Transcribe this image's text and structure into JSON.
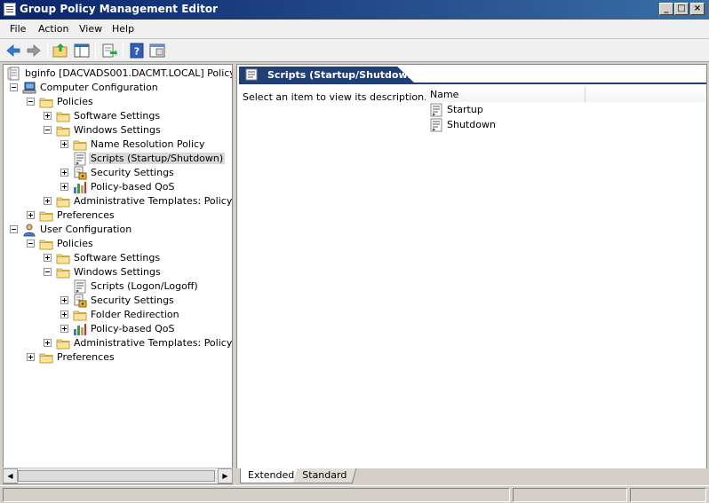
{
  "window": {
    "title": "Group Policy Management Editor"
  },
  "menu": [
    "File",
    "Action",
    "View",
    "Help"
  ],
  "toolbar": [
    "back-icon",
    "forward-icon",
    "up-folder-icon",
    "show-hide-tree-icon",
    "export-list-icon",
    "help-icon",
    "properties-icon"
  ],
  "tree": [
    {
      "label": "bginfo [DACVADS001.DACMT.LOCAL] Policy",
      "icon": "policy-doc-icon",
      "expander": "none",
      "level": 0
    },
    {
      "label": "Computer Configuration",
      "icon": "computer-icon",
      "expander": "minus",
      "level": 1
    },
    {
      "label": "Policies",
      "icon": "folder-icon",
      "expander": "minus",
      "level": 2
    },
    {
      "label": "Software Settings",
      "icon": "folder-icon",
      "expander": "plus",
      "level": 3
    },
    {
      "label": "Windows Settings",
      "icon": "folder-icon",
      "expander": "minus",
      "level": 3
    },
    {
      "label": "Name Resolution Policy",
      "icon": "folder-icon",
      "expander": "plus",
      "level": 4
    },
    {
      "label": "Scripts (Startup/Shutdown)",
      "icon": "script-icon",
      "expander": "none",
      "level": 4,
      "selected": true
    },
    {
      "label": "Security Settings",
      "icon": "security-icon",
      "expander": "plus",
      "level": 4
    },
    {
      "label": "Policy-based QoS",
      "icon": "qos-chart-icon",
      "expander": "plus",
      "level": 4
    },
    {
      "label": "Administrative Templates: Policy defi",
      "icon": "folder-icon",
      "expander": "plus",
      "level": 3
    },
    {
      "label": "Preferences",
      "icon": "folder-icon",
      "expander": "plus",
      "level": 2
    },
    {
      "label": "User Configuration",
      "icon": "user-icon",
      "expander": "minus",
      "level": 1
    },
    {
      "label": "Policies",
      "icon": "folder-icon",
      "expander": "minus",
      "level": 2
    },
    {
      "label": "Software Settings",
      "icon": "folder-icon",
      "expander": "plus",
      "level": 3
    },
    {
      "label": "Windows Settings",
      "icon": "folder-icon",
      "expander": "minus",
      "level": 3
    },
    {
      "label": "Scripts (Logon/Logoff)",
      "icon": "script-icon",
      "expander": "none",
      "level": 4
    },
    {
      "label": "Security Settings",
      "icon": "security-icon",
      "expander": "plus",
      "level": 4
    },
    {
      "label": "Folder Redirection",
      "icon": "folder-icon",
      "expander": "plus",
      "level": 4
    },
    {
      "label": "Policy-based QoS",
      "icon": "qos-chart-icon",
      "expander": "plus",
      "level": 4
    },
    {
      "label": "Administrative Templates: Policy defi",
      "icon": "folder-icon",
      "expander": "plus",
      "level": 3
    },
    {
      "label": "Preferences",
      "icon": "folder-icon",
      "expander": "plus",
      "level": 2
    }
  ],
  "details": {
    "header": "Scripts (Startup/Shutdown)",
    "description": "Select an item to view its description.",
    "column_name": "Name",
    "items": [
      "Startup",
      "Shutdown"
    ]
  },
  "tabs": {
    "extended": "Extended",
    "standard": "Standard"
  },
  "colors": {
    "header_band": "#1f3f75",
    "title_gradient_start": "#0a246a",
    "folder": "#f5d77a"
  }
}
